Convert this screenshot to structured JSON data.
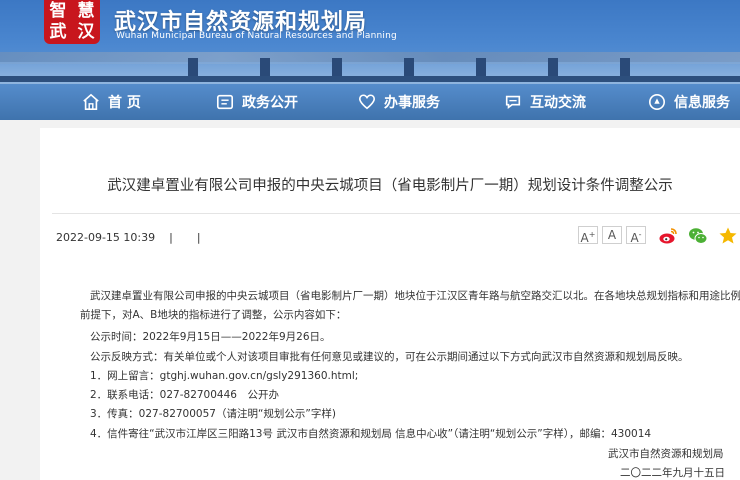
{
  "header": {
    "logo_chars": [
      "智",
      "慧",
      "武",
      "汉"
    ],
    "title": "武汉市自然资源和规划局",
    "subtitle": "Wuhan Municipal Bureau of Natural Resources and Planning"
  },
  "nav": {
    "items": [
      {
        "label": "首 页",
        "icon": "home-icon"
      },
      {
        "label": "政务公开",
        "icon": "gov-affairs-icon"
      },
      {
        "label": "办事服务",
        "icon": "heart-service-icon"
      },
      {
        "label": "互动交流",
        "icon": "chat-icon"
      },
      {
        "label": "信息服务",
        "icon": "info-icon"
      }
    ]
  },
  "article": {
    "title": "武汉建卓置业有限公司申报的中央云城项目（省电影制片厂一期）规划设计条件调整公示",
    "date": "2022-09-15 10:39",
    "sep1": "|",
    "sep2": "|",
    "font_buttons": [
      "A",
      "A",
      "A"
    ],
    "font_sup": [
      "+",
      "",
      "-"
    ],
    "share_icons": [
      "weibo-icon",
      "wechat-icon",
      "favorite-icon"
    ],
    "para1_a": "武汉建卓置业有限公司申报的中央云城项目（省电影制片厂一期）地块位于江汉区青年路与航空路交汇以北。在各地块总规划指标和用途比例不变的",
    "para1_b": "前提下，对A、B地块的指标进行了调整，公示内容如下：",
    "time": "公示时间：2022年9月15日——2022年9月26日。",
    "feedback": "公示反映方式：有关单位或个人对该项目审批有任何意见或建议的，可在公示期间通过以下方式向武汉市自然资源和规划局反映。",
    "method1": "1．网上留言：gtghj.wuhan.gov.cn/gsly291360.html;",
    "method2": "2．联系电话：027-82700446　公开办",
    "method3": "3．传真：027-82700057（请注明“规划公示”字样)",
    "method4": "4．信件寄往“武汉市江岸区三阳路13号 武汉市自然资源和规划局 信息中心收”（请注明“规划公示”字样），邮编：430014",
    "signature": "武汉市自然资源和规划局",
    "sign_date": "二〇二二年九月十五日"
  },
  "colors": {
    "header_blue": "#3c78c4",
    "logo_red": "#c8161d",
    "weibo_red": "#e6162d",
    "wechat_green": "#4cb035",
    "star_yellow": "#f5b800"
  }
}
